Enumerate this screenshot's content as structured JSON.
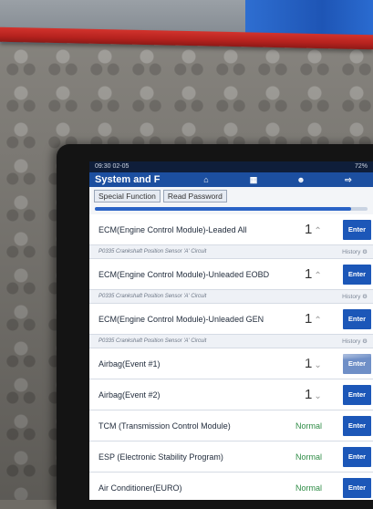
{
  "status_bar": {
    "left": "09:30  02-05",
    "right": "72%"
  },
  "app": {
    "title": "System and F",
    "home_icon": "home-icon",
    "doc_icon": "report-icon",
    "user_icon": "user-icon",
    "exit_icon": "exit-icon"
  },
  "tabs": [
    {
      "label": "Special Function"
    },
    {
      "label": "Read Password"
    }
  ],
  "progress": {
    "fraction": 0.94
  },
  "rows": [
    {
      "name": "ECM(Engine Control Module)-Leaded All",
      "count": "1",
      "button": "Enter",
      "note": "P0335 Crankshaft Position Sensor 'A' Circuit",
      "history": "History"
    },
    {
      "name": "ECM(Engine Control Module)-Unleaded EOBD",
      "count": "1",
      "button": "Enter",
      "note": "P0335 Crankshaft Position Sensor 'A' Circuit",
      "history": "History"
    },
    {
      "name": "ECM(Engine Control Module)-Unleaded GEN",
      "count": "1",
      "button": "Enter",
      "note": "P0335 Crankshaft Position Sensor 'A' Circuit",
      "history": "History"
    },
    {
      "name": "Airbag(Event #1)",
      "count": "1",
      "button": "Enter"
    },
    {
      "name": "Airbag(Event #2)",
      "count": "1",
      "button": "Enter"
    },
    {
      "name": "TCM (Transmission Control Module)",
      "status": "Normal",
      "button": "Enter"
    },
    {
      "name": "ESP (Electronic Stability Program)",
      "status": "Normal",
      "button": "Enter"
    },
    {
      "name": "Air Conditioner(EURO)",
      "status": "Normal",
      "button": "Enter"
    }
  ]
}
